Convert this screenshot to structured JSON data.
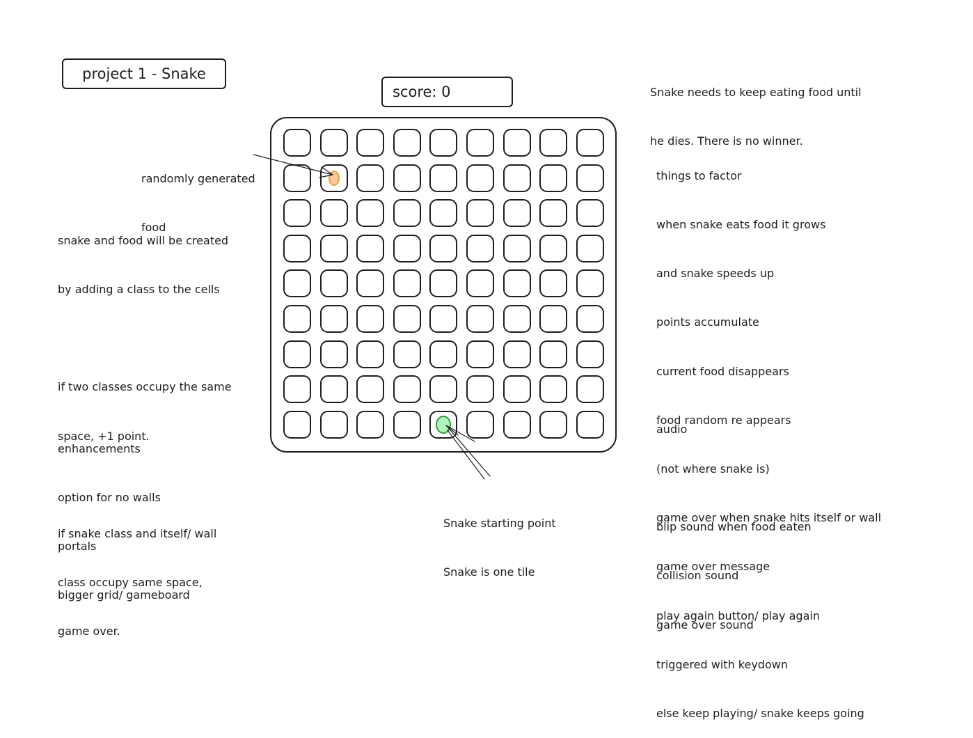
{
  "title": "project 1 - Snake",
  "score_label": "score: 0",
  "game_summary": [
    "Snake needs to keep eating food until",
    "he dies. There is no winner."
  ],
  "food_annotation": [
    "randomly generated",
    "food"
  ],
  "snake_annotation": [
    "Snake starting point",
    "Snake is one tile"
  ],
  "class_notes": [
    "snake and food will be created",
    "by adding a class to the cells",
    "",
    "if two classes occupy the same",
    "space, +1 point.",
    "",
    "if snake class and itself/ wall",
    "class occupy same space,",
    "game over."
  ],
  "enhancements": [
    "enhancements",
    "option for no walls",
    "portals",
    "bigger grid/ gameboard"
  ],
  "factors": [
    "things to factor",
    "when snake eats food it grows",
    "and snake speeds up",
    "points accumulate",
    "current food disappears",
    "food random re appears",
    "(not where snake is)",
    "game over when snake hits itself or wall",
    "game over message",
    "play again button/ play again",
    "triggered with keydown",
    "else keep playing/ snake keeps going"
  ],
  "audio": [
    "audio",
    "",
    "blip sound when food eaten",
    "collision sound",
    "game over sound"
  ],
  "grid": {
    "columns": 9,
    "rows": 9,
    "food": {
      "row": 2,
      "col": 2,
      "fill": "#ffc9a0",
      "stroke": "#e8a33a"
    },
    "snake": {
      "row": 9,
      "col": 5,
      "fill": "#b2f2bb",
      "stroke": "#2f9e44"
    }
  },
  "colors": {
    "ink": "#1e1e1e",
    "background": "#ffffff"
  }
}
